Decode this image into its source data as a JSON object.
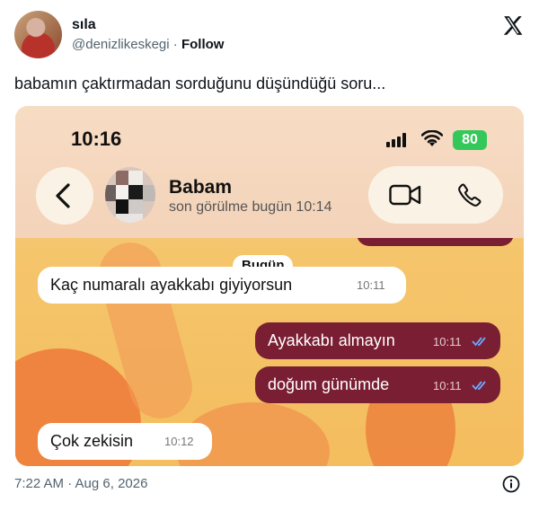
{
  "tweet": {
    "author_name": "sıla",
    "handle": "@denizlikeskegi",
    "separator": " · ",
    "follow_label": "Follow",
    "text": "babamın çaktırmadan sorduğunu düşündüğü soru...",
    "timestamp": "7:22 AM · Aug 6, 2026"
  },
  "phone": {
    "status_time": "10:16",
    "battery": "80",
    "contact": {
      "name": "Babam",
      "status": "son görülme bugün 10:14"
    },
    "date_divider": "Bugün",
    "messages": [
      {
        "direction": "in",
        "text": "Kaç numaralı ayakkabı giyiyorsun",
        "time": "10:11"
      },
      {
        "direction": "out",
        "text": "Ayakkabı almayın",
        "time": "10:11",
        "status": "read"
      },
      {
        "direction": "out",
        "text": "doğum günümde",
        "time": "10:11",
        "status": "read"
      },
      {
        "direction": "in",
        "text": "Çok zekisin",
        "time": "10:12"
      }
    ]
  },
  "colors": {
    "outgoing_bubble": "#7a1f33",
    "read_ticks": "#6fa8ff",
    "battery": "#34c759"
  },
  "icons": [
    "x-logo-icon",
    "back-chevron-icon",
    "video-call-icon",
    "phone-call-icon",
    "signal-icon",
    "wifi-icon",
    "info-icon",
    "read-ticks-icon"
  ]
}
